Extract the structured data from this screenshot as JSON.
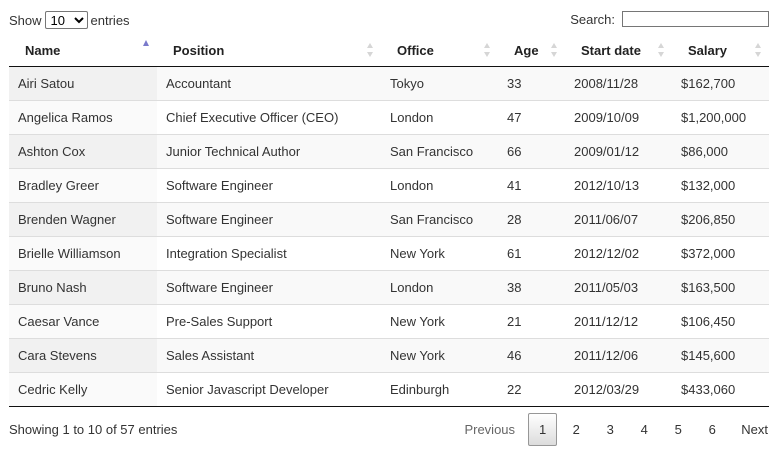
{
  "length_menu": {
    "prefix": "Show",
    "selected": "10",
    "suffix": "entries"
  },
  "search": {
    "label": "Search:",
    "value": ""
  },
  "columns": [
    "Name",
    "Position",
    "Office",
    "Age",
    "Start date",
    "Salary"
  ],
  "sorted_column": "Name",
  "sort_direction": "ascending",
  "rows": [
    [
      "Airi Satou",
      "Accountant",
      "Tokyo",
      "33",
      "2008/11/28",
      "$162,700"
    ],
    [
      "Angelica Ramos",
      "Chief Executive Officer (CEO)",
      "London",
      "47",
      "2009/10/09",
      "$1,200,000"
    ],
    [
      "Ashton Cox",
      "Junior Technical Author",
      "San Francisco",
      "66",
      "2009/01/12",
      "$86,000"
    ],
    [
      "Bradley Greer",
      "Software Engineer",
      "London",
      "41",
      "2012/10/13",
      "$132,000"
    ],
    [
      "Brenden Wagner",
      "Software Engineer",
      "San Francisco",
      "28",
      "2011/06/07",
      "$206,850"
    ],
    [
      "Brielle Williamson",
      "Integration Specialist",
      "New York",
      "61",
      "2012/12/02",
      "$372,000"
    ],
    [
      "Bruno Nash",
      "Software Engineer",
      "London",
      "38",
      "2011/05/03",
      "$163,500"
    ],
    [
      "Caesar Vance",
      "Pre-Sales Support",
      "New York",
      "21",
      "2011/12/12",
      "$106,450"
    ],
    [
      "Cara Stevens",
      "Sales Assistant",
      "New York",
      "46",
      "2011/12/06",
      "$145,600"
    ],
    [
      "Cedric Kelly",
      "Senior Javascript Developer",
      "Edinburgh",
      "22",
      "2012/03/29",
      "$433,060"
    ]
  ],
  "info": "Showing 1 to 10 of 57 entries",
  "pagination": {
    "previous": "Previous",
    "pages": [
      "1",
      "2",
      "3",
      "4",
      "5",
      "6"
    ],
    "current": "1",
    "next": "Next"
  },
  "colors": {
    "sort_active": "#7a7acb",
    "sort_inactive": "#d6d6d6",
    "row_stripe": "#f9f9f9"
  }
}
